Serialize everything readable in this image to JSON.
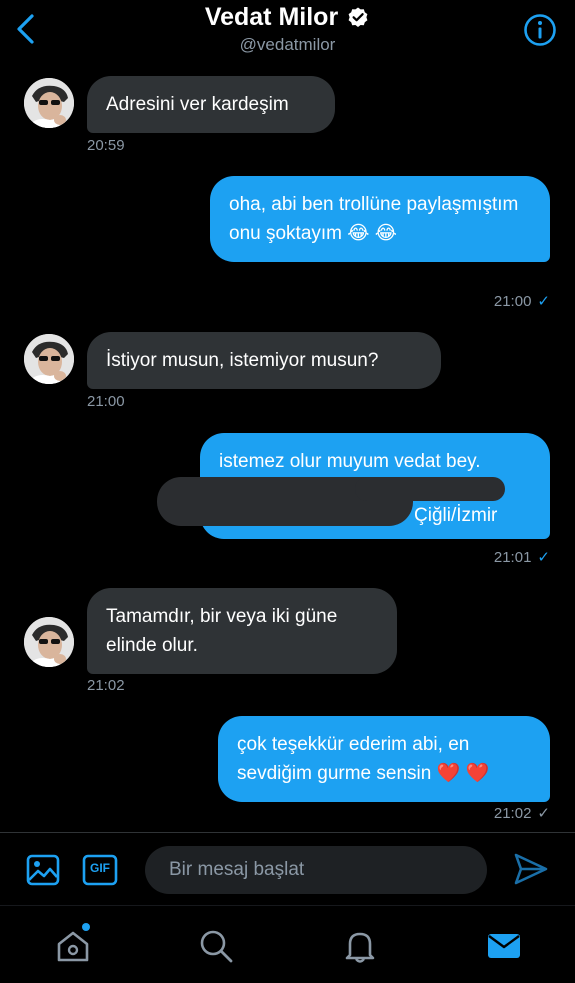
{
  "header": {
    "title": "Vedat Milor",
    "handle": "@vedatmilor"
  },
  "messages": [
    {
      "dir": "in",
      "text": "Adresini ver kardeşim",
      "time": "20:59"
    },
    {
      "dir": "out",
      "text": "oha, abi ben trollüne paylaşmıştım onu şoktayım 😂 😂",
      "time": "21:00",
      "tick": "✓"
    },
    {
      "dir": "in",
      "text": "İstiyor musun, istemiyor musun?",
      "time": "21:00"
    },
    {
      "dir": "out",
      "text": "istemez olur muyum vedat bey.",
      "text_visible_end": "Çiğli/İzmir",
      "time": "21:01",
      "tick": "✓"
    },
    {
      "dir": "in",
      "text": "Tamamdır, bir veya iki güne elinde olur.",
      "time": "21:02"
    },
    {
      "dir": "out",
      "text": "çok teşekkür ederim abi, en sevdiğim gurme sensin ❤️ ❤️",
      "time": "21:02",
      "tick": "✓"
    }
  ],
  "composer": {
    "placeholder": "Bir mesaj başlat",
    "gif_label": "GIF"
  },
  "colors": {
    "background": "#000000",
    "accent": "#1da1f2",
    "incoming_bubble": "#2f3336",
    "muted_text": "#8b98a5"
  },
  "icons": {
    "back": "chevron-left-icon",
    "verified": "verified-badge-icon",
    "info": "info-icon",
    "image": "image-icon",
    "gif": "gif-icon",
    "send": "send-icon",
    "home": "home-icon",
    "search": "search-icon",
    "notifications": "bell-icon",
    "messages": "mail-icon"
  }
}
